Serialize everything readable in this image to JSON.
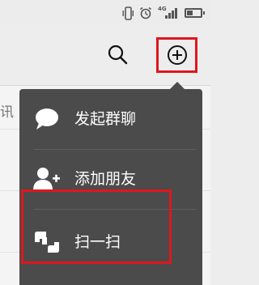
{
  "status_bar": {
    "icons": [
      "vibrate-icon",
      "alarm-icon",
      "signal-icon",
      "battery-icon"
    ],
    "network_label": "4G"
  },
  "toolbar": {
    "search_icon": "search-icon",
    "add_icon": "plus-circle-icon"
  },
  "background_list": {
    "partial_text": "讯"
  },
  "popup_menu": {
    "items": [
      {
        "label": "发起群聊",
        "icon": "chat-bubble-icon"
      },
      {
        "label": "添加朋友",
        "icon": "add-friend-icon"
      },
      {
        "label": "扫一扫",
        "icon": "scan-icon"
      }
    ]
  },
  "colors": {
    "highlight": "#e0161d",
    "popup_bg": "#4b4b4b",
    "toolbar_bg": "#ededed"
  }
}
